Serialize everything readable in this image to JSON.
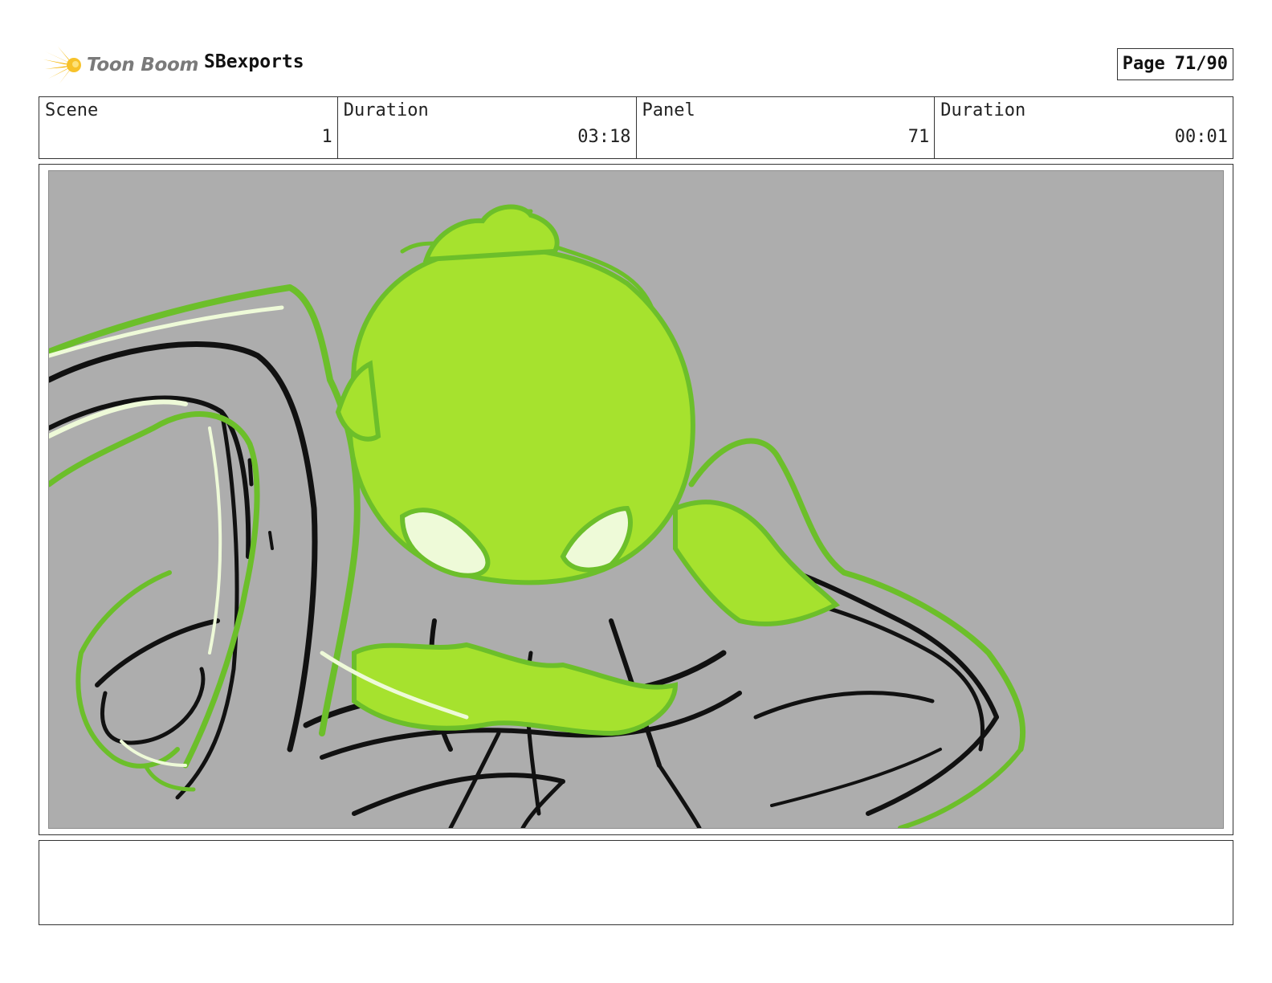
{
  "header": {
    "logo_text": "Toon Boom",
    "project_name": "SBexports",
    "page_label": "Page",
    "page_value": "71/90"
  },
  "info": {
    "scene_label": "Scene",
    "scene_value": "1",
    "scene_duration_label": "Duration",
    "scene_duration_value": "03:18",
    "panel_label": "Panel",
    "panel_value": "71",
    "panel_duration_label": "Duration",
    "panel_duration_value": "00:01"
  },
  "panel": {
    "background_color": "#adadad",
    "glow_color": "#a6e22e",
    "glow_dark_color": "#6cbf2a",
    "highlight_color": "#eefad8",
    "ink_color": "#111111"
  },
  "notes": {
    "text": ""
  }
}
